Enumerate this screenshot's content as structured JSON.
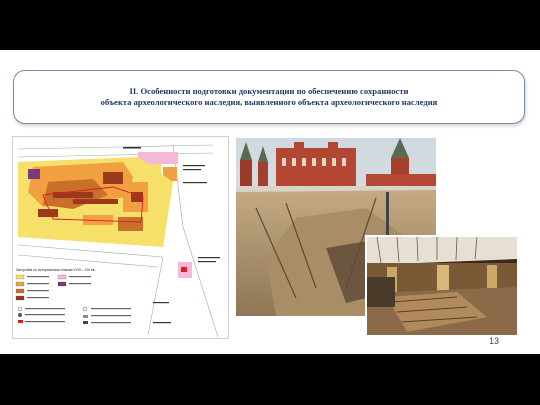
{
  "slide": {
    "title_line_1": "II. Особенности подготовки документации по обеспечению сохранности",
    "title_line_2": "объекта археологического наследия, выявленного объекта археологического наследия",
    "page_number": "13"
  },
  "map": {
    "legend_title": "Застройка по историческим планам XVIII – XIX вв."
  },
  "colors": {
    "title_text": "#1f3864",
    "title_border": "#7a8ba8",
    "map_orange": "#f0a040",
    "map_yellow": "#f7e06a",
    "map_brown": "#9a3a1a",
    "map_pink": "#f4b8d8",
    "map_purple": "#7a3a7a"
  }
}
